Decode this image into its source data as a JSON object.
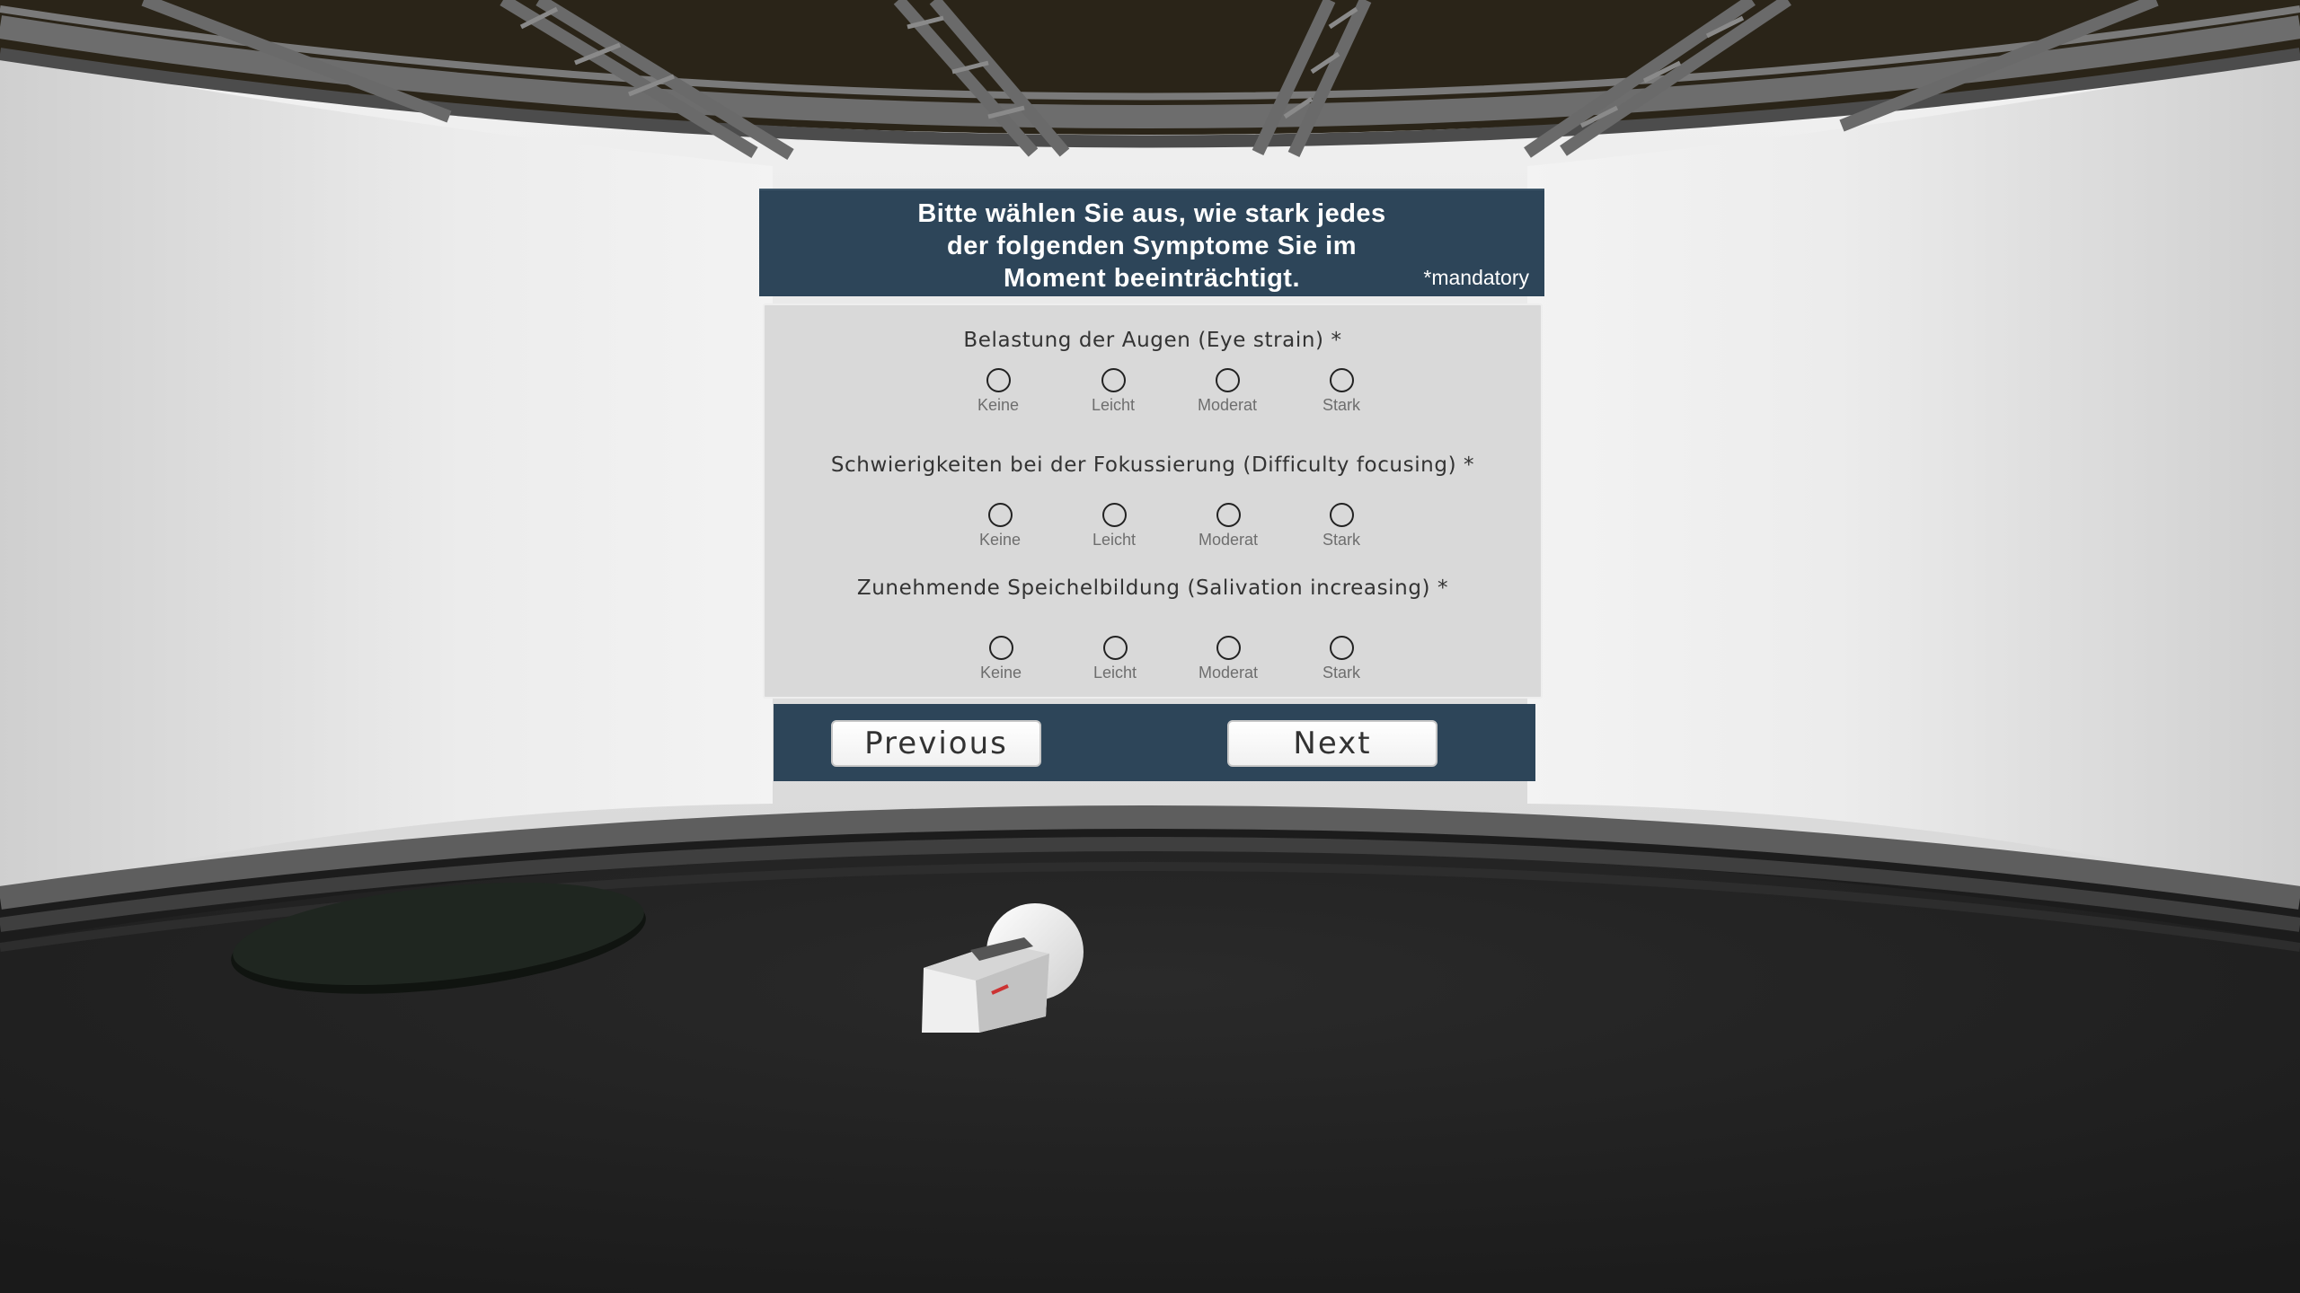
{
  "header": {
    "title_lines": [
      "Bitte wählen Sie aus, wie stark jedes",
      "der folgenden Symptome Sie im",
      "Moment beeinträchtigt."
    ],
    "mandatory_note": "*mandatory"
  },
  "questions": [
    {
      "label": "Belastung der Augen (Eye strain) *",
      "options": [
        "Keine",
        "Leicht",
        "Moderat",
        "Stark"
      ],
      "selected": null
    },
    {
      "label": "Schwierigkeiten bei der Fokussierung (Difficulty focusing) *",
      "options": [
        "Keine",
        "Leicht",
        "Moderat",
        "Stark"
      ],
      "selected": null
    },
    {
      "label": "Zunehmende Speichelbildung (Salivation increasing) *",
      "options": [
        "Keine",
        "Leicht",
        "Moderat",
        "Stark"
      ],
      "selected": null
    }
  ],
  "navigation": {
    "previous_label": "Previous",
    "next_label": "Next"
  },
  "colors": {
    "panel_header": "#2d4559",
    "panel_body": "#d9d9d9",
    "floor": "#1e1e1e",
    "ceiling": "#2a2418",
    "wall": "#e6e6e6"
  }
}
